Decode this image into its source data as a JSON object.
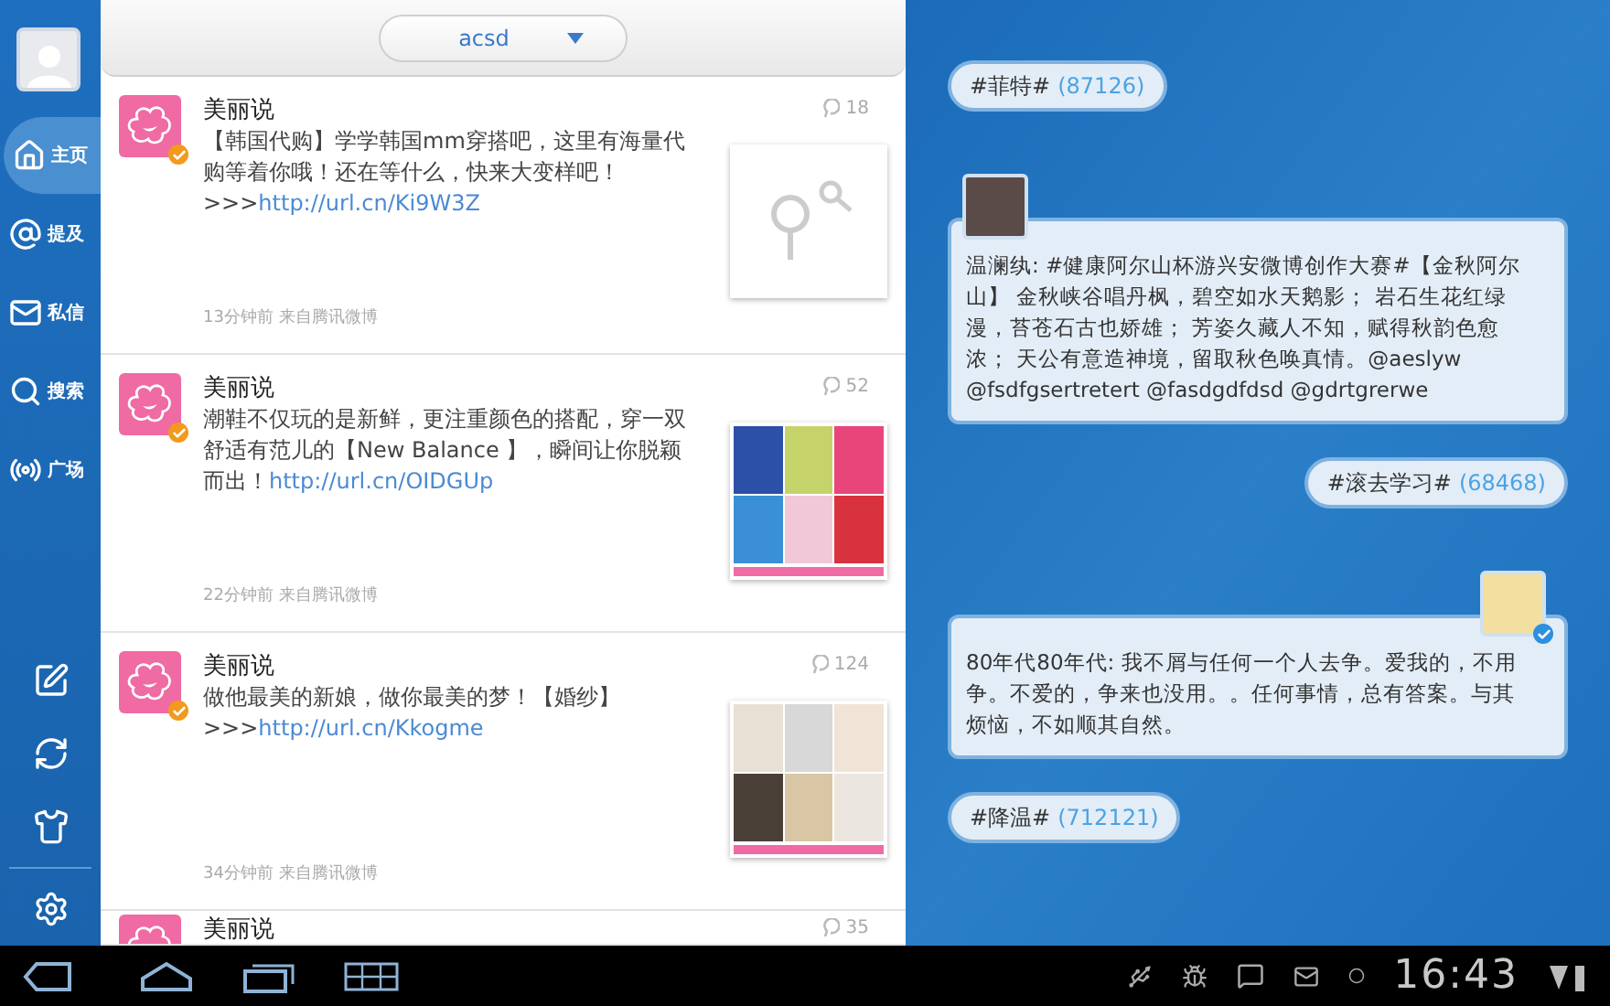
{
  "sidebar": {
    "items": [
      {
        "label": "主页",
        "selected": true
      },
      {
        "label": "提及",
        "selected": false
      },
      {
        "label": "私信",
        "selected": false
      },
      {
        "label": "搜索",
        "selected": false
      },
      {
        "label": "广场",
        "selected": false
      }
    ]
  },
  "feed": {
    "selector": "acsd",
    "posts": [
      {
        "author": "美丽说",
        "verified": true,
        "count": "18",
        "text": "【韩国代购】学学韩国mm穿搭吧，这里有海量代购等着你哦！还在等什么，快来大变样吧！>>>",
        "link": "http://url.cn/Ki9W3Z",
        "meta": "13分钟前 来自腾讯微博"
      },
      {
        "author": "美丽说",
        "verified": true,
        "count": "52",
        "text": "潮鞋不仅玩的是新鲜，更注重颜色的搭配，穿一双舒适有范儿的【New Balance 】，瞬间让你脱颖而出！",
        "link": "http://url.cn/OIDGUp",
        "meta": "22分钟前 来自腾讯微博"
      },
      {
        "author": "美丽说",
        "verified": true,
        "count": "124",
        "text": "做他最美的新娘，做你最美的梦！【婚纱】>>>",
        "link": "http://url.cn/Kkogme",
        "meta": "34分钟前 来自腾讯微博"
      },
      {
        "author": "美丽说",
        "count": "35"
      }
    ]
  },
  "panel": {
    "items": [
      {
        "kind": "topic",
        "text": "#菲特#",
        "count": "(87126)"
      },
      {
        "kind": "status",
        "verified": false,
        "text": "温澜纨: #健康阿尔山杯游兴安微博创作大赛#【金秋阿尔山】 金秋峡谷唱丹枫，碧空如水天鹅影； 岩石生花红绿漫，苔苍石古也娇雄； 芳姿久藏人不知，赋得秋韵色愈浓； 天公有意造神境，留取秋色唤真情。@aeslyw @fsdfgsertretert @fasdgdfdsd @gdrtgrerwe"
      },
      {
        "kind": "topic",
        "text": "#滚去学习#",
        "count": "(68468)"
      },
      {
        "kind": "status",
        "verified": true,
        "text": "80年代80年代: 我不屑与任何一个人去争。爱我的，不用争。不爱的，争来也没用。。任何事情，总有答案。与其烦恼，不如顺其自然。"
      },
      {
        "kind": "topic",
        "text": "#降温#",
        "count": "(712121)"
      }
    ]
  },
  "status_bar": {
    "time": "16:43"
  }
}
